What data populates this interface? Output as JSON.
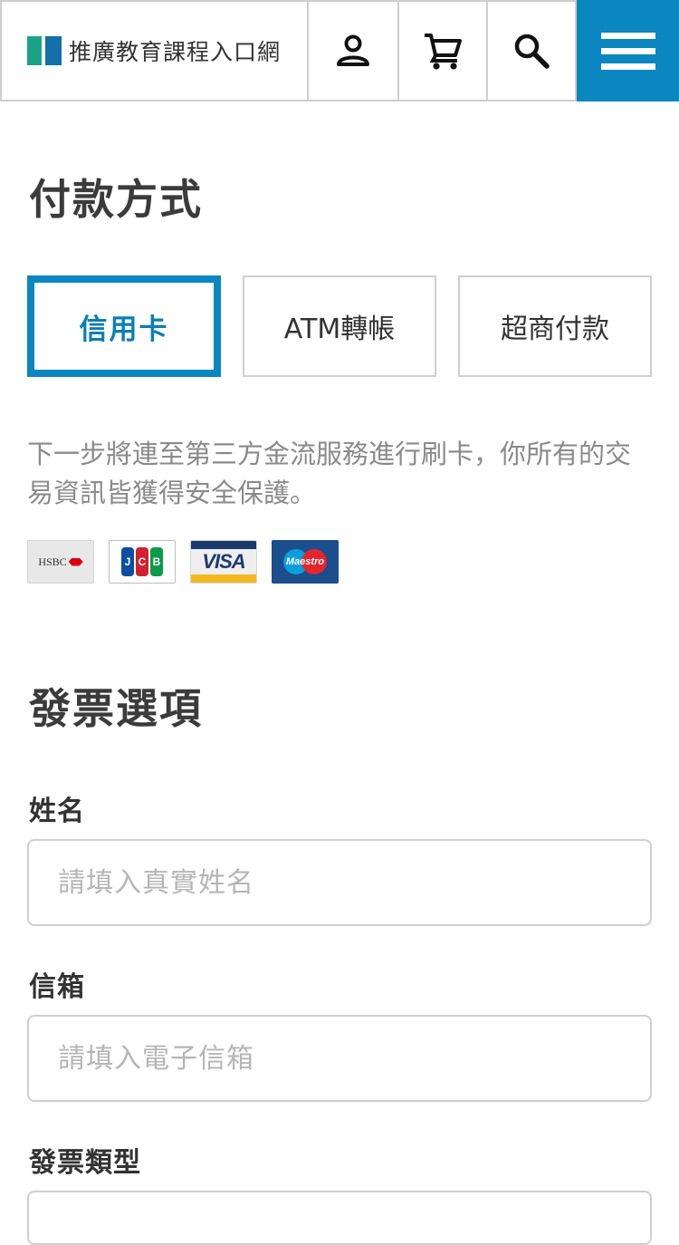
{
  "header": {
    "brand_name": "推廣教育課程入口網"
  },
  "payment": {
    "title": "付款方式",
    "tabs": [
      {
        "label": "信用卡",
        "selected": true
      },
      {
        "label": "ATM轉帳",
        "selected": false
      },
      {
        "label": "超商付款",
        "selected": false
      }
    ],
    "note": "下一步將連至第三方金流服務進行刷卡，你所有的交易資訊皆獲得安全保護。",
    "cards": {
      "hsbc": "HSBC",
      "jcb": [
        "J",
        "C",
        "B"
      ],
      "visa": "VISA",
      "maestro": "Maestro"
    }
  },
  "invoice": {
    "title": "發票選項",
    "name_label": "姓名",
    "name_placeholder": "請填入真實姓名",
    "email_label": "信箱",
    "email_placeholder": "請填入電子信箱",
    "type_label": "發票類型"
  },
  "colors": {
    "accent": "#0a86c0",
    "logo_green": "#1aa388",
    "logo_blue": "#1370a8"
  }
}
